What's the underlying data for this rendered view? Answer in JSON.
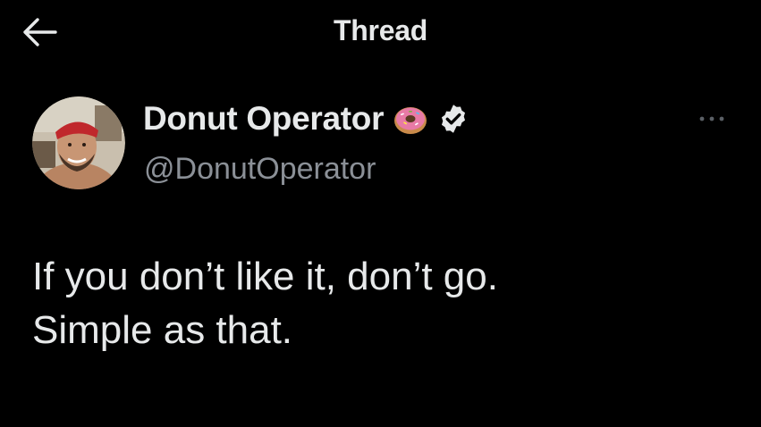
{
  "header": {
    "title": "Thread",
    "back_icon": "arrow-left-icon"
  },
  "tweet": {
    "author": {
      "display_name": "Donut Operator",
      "name_emoji": "donut-emoji-icon",
      "verified": true,
      "verified_icon": "verified-badge-icon",
      "handle": "@DonutOperator",
      "avatar_icon": "avatar"
    },
    "more_icon": "more-options-icon",
    "text": "If you don’t like it, don’t go.\nSimple as that."
  },
  "colors": {
    "background": "#000000",
    "primary_text": "#e7e9ea",
    "secondary_text": "#8b9097",
    "verified_badge": "#e7e9ea"
  }
}
